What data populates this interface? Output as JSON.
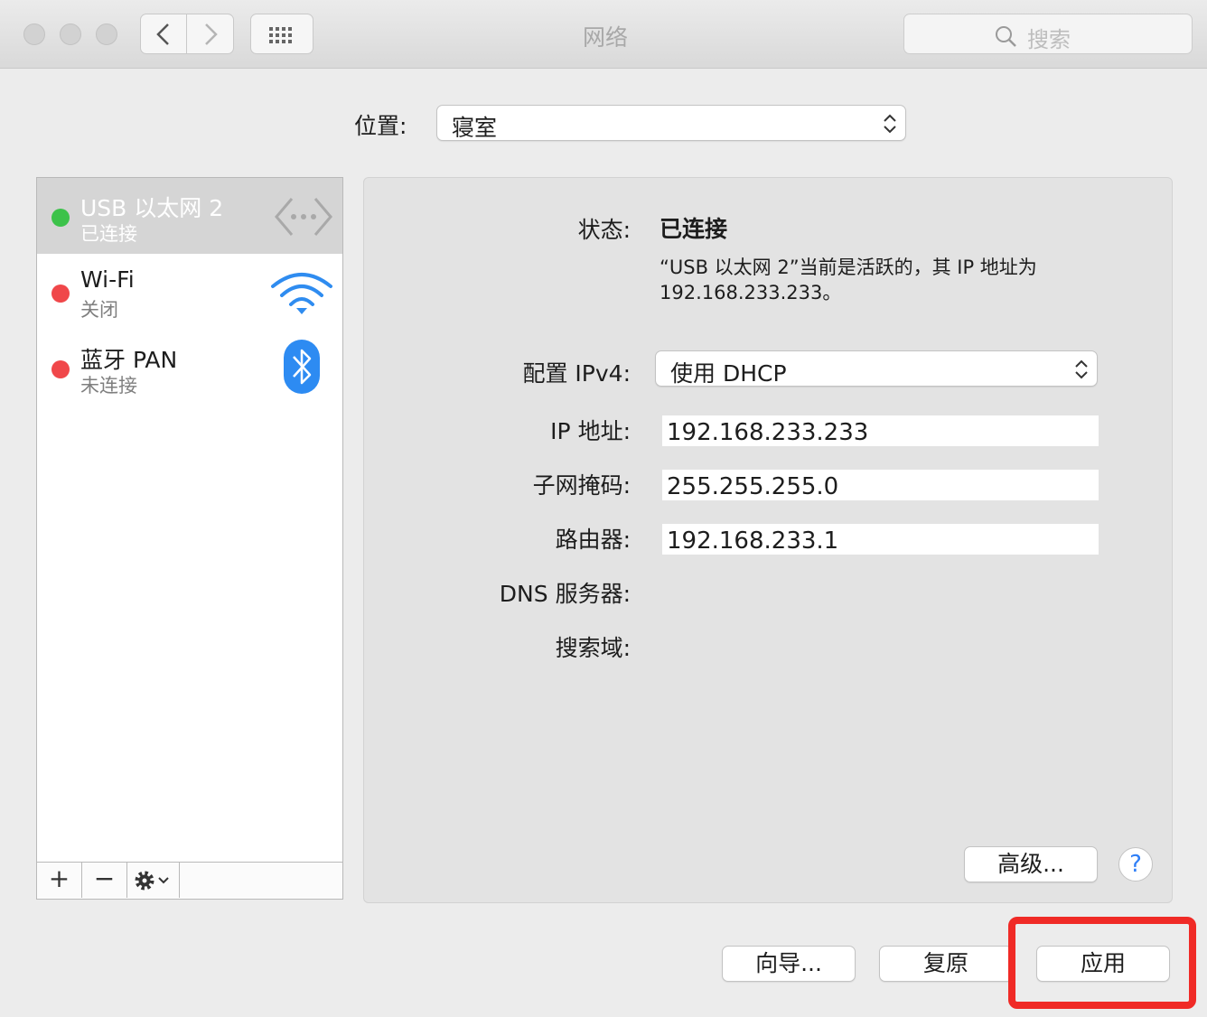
{
  "window": {
    "title": "网络",
    "search_placeholder": "搜索"
  },
  "location": {
    "label": "位置:",
    "value": "寝室"
  },
  "services": [
    {
      "name": "USB 以太网 2",
      "status": "已连接",
      "dot_color": "#3cc24a",
      "icon": "ethernet-icon",
      "selected": true
    },
    {
      "name": "Wi-Fi",
      "status": "关闭",
      "dot_color": "#f0474a",
      "icon": "wifi-icon",
      "selected": false
    },
    {
      "name": "蓝牙 PAN",
      "status": "未连接",
      "dot_color": "#f0474a",
      "icon": "bluetooth-icon",
      "selected": false
    }
  ],
  "list_toolbar": {
    "add": "+",
    "remove": "−",
    "gear": "gear-icon"
  },
  "detail": {
    "status_label": "状态:",
    "status_value": "已连接",
    "status_desc_line1": "“USB 以太网 2”当前是活跃的，其 IP 地址为",
    "status_desc_line2": "192.168.233.233。",
    "ipv4_label": "配置 IPv4:",
    "ipv4_value": "使用 DHCP",
    "ip_label": "IP 地址:",
    "ip_value": "192.168.233.233",
    "subnet_label": "子网掩码:",
    "subnet_value": "255.255.255.0",
    "router_label": "路由器:",
    "router_value": "192.168.233.1",
    "dns_label": "DNS 服务器:",
    "search_domain_label": "搜索域:",
    "advanced_button": "高级...",
    "help_button": "?"
  },
  "footer": {
    "assist_button": "向导...",
    "revert_button": "复原",
    "apply_button": "应用"
  },
  "colors": {
    "highlight": "#f02a26",
    "connected": "#3cc24a",
    "disconnected": "#f0474a"
  }
}
